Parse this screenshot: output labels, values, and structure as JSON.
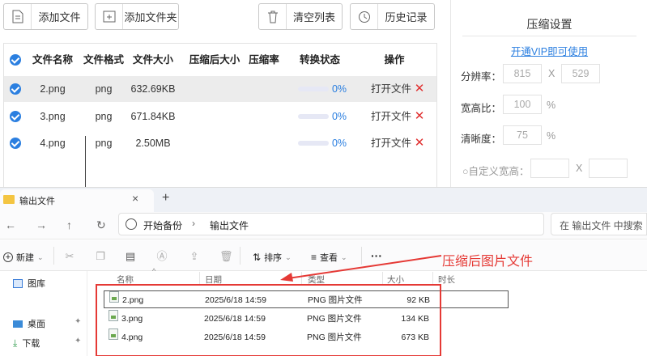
{
  "toolbar": {
    "add_file": "添加文件",
    "add_folder": "添加文件夹",
    "clear_list": "清空列表",
    "history": "历史记录"
  },
  "file_table": {
    "headers": [
      "文件名称",
      "文件格式",
      "文件大小",
      "压缩后大小",
      "压缩率",
      "转换状态",
      "操作"
    ],
    "rows": [
      {
        "name": "2.png",
        "format": "png",
        "size": "632.69KB",
        "percent": "0%",
        "open": "打开文件"
      },
      {
        "name": "3.png",
        "format": "png",
        "size": "671.84KB",
        "percent": "0%",
        "open": "打开文件"
      },
      {
        "name": "4.png",
        "format": "png",
        "size": "2.50MB",
        "percent": "0%",
        "open": "打开文件"
      }
    ]
  },
  "settings": {
    "title": "压缩设置",
    "vip_link": "开通VIP即可使用",
    "resolution_label": "分辨率：",
    "res_w": "815",
    "res_sep": "X",
    "res_h": "529",
    "aspect_label": "宽高比：",
    "aspect_value": "100",
    "aspect_unit": "%",
    "clarity_label": "清晰度：",
    "clarity_value": "75",
    "clarity_unit": "%",
    "custom_label": "○自定义宽高：",
    "custom_sep": "X"
  },
  "explorer": {
    "tab_title": "输出文件",
    "new_tab": "+",
    "close": "×",
    "breadcrumb_root": "开始备份",
    "breadcrumb_current": "输出文件",
    "search_placeholder": "在 输出文件 中搜索",
    "new_label": "新建",
    "sort_label": "排序",
    "view_label": "查看",
    "more_label": "···",
    "nav": {
      "gallery": "图库",
      "desktop": "桌面",
      "downloads": "下载"
    },
    "columns": {
      "name": "名称",
      "date": "日期",
      "type": "类型",
      "size": "大小",
      "duration": "时长"
    },
    "files": [
      {
        "name": "2.png",
        "date": "2025/6/18 14:59",
        "type": "PNG 图片文件",
        "size": "92 KB"
      },
      {
        "name": "3.png",
        "date": "2025/6/18 14:59",
        "type": "PNG 图片文件",
        "size": "134 KB"
      },
      {
        "name": "4.png",
        "date": "2025/6/18 14:59",
        "type": "PNG 图片文件",
        "size": "673 KB"
      }
    ]
  },
  "annotation": "压缩后图片文件",
  "colors": {
    "accent": "#2b7fe0",
    "danger": "#e53935"
  }
}
